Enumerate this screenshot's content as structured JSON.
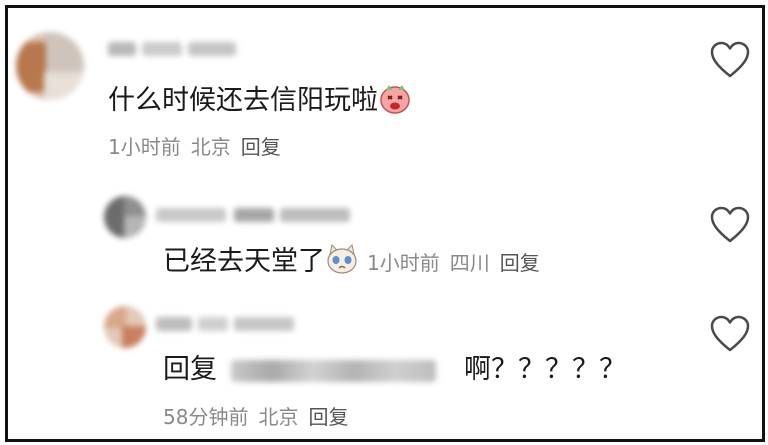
{
  "comments": [
    {
      "text": "什么时候还去信阳玩啦",
      "emoji": "red-face-emoji",
      "time": "1小时前",
      "location": "北京",
      "reply_label": "回复"
    },
    {
      "text": "已经去天堂了",
      "emoji": "crying-cat-emoji",
      "time": "1小时前",
      "location": "四川",
      "reply_label": "回复"
    },
    {
      "reply_prefix": "回复",
      "text": "啊？？？？？",
      "time": "58分钟前",
      "location": "北京",
      "reply_label": "回复"
    }
  ],
  "colors": {
    "border": "#111111",
    "text": "#1b1b1b",
    "meta": "#8a8a8a",
    "heart": "#4a4a4a"
  },
  "icons": [
    "heart-outline-icon",
    "red-face-emoji",
    "crying-cat-emoji"
  ]
}
